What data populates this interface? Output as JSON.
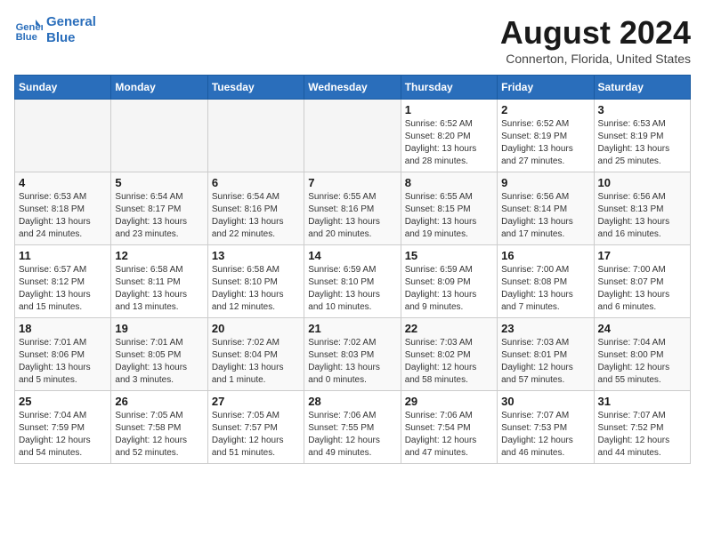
{
  "logo": {
    "line1": "General",
    "line2": "Blue"
  },
  "title": "August 2024",
  "location": "Connerton, Florida, United States",
  "weekdays": [
    "Sunday",
    "Monday",
    "Tuesday",
    "Wednesday",
    "Thursday",
    "Friday",
    "Saturday"
  ],
  "weeks": [
    [
      {
        "day": "",
        "empty": true
      },
      {
        "day": "",
        "empty": true
      },
      {
        "day": "",
        "empty": true
      },
      {
        "day": "",
        "empty": true
      },
      {
        "day": "1",
        "sunrise": "6:52 AM",
        "sunset": "8:20 PM",
        "daylight": "13 hours and 28 minutes."
      },
      {
        "day": "2",
        "sunrise": "6:52 AM",
        "sunset": "8:19 PM",
        "daylight": "13 hours and 27 minutes."
      },
      {
        "day": "3",
        "sunrise": "6:53 AM",
        "sunset": "8:19 PM",
        "daylight": "13 hours and 25 minutes."
      }
    ],
    [
      {
        "day": "4",
        "sunrise": "6:53 AM",
        "sunset": "8:18 PM",
        "daylight": "13 hours and 24 minutes."
      },
      {
        "day": "5",
        "sunrise": "6:54 AM",
        "sunset": "8:17 PM",
        "daylight": "13 hours and 23 minutes."
      },
      {
        "day": "6",
        "sunrise": "6:54 AM",
        "sunset": "8:16 PM",
        "daylight": "13 hours and 22 minutes."
      },
      {
        "day": "7",
        "sunrise": "6:55 AM",
        "sunset": "8:16 PM",
        "daylight": "13 hours and 20 minutes."
      },
      {
        "day": "8",
        "sunrise": "6:55 AM",
        "sunset": "8:15 PM",
        "daylight": "13 hours and 19 minutes."
      },
      {
        "day": "9",
        "sunrise": "6:56 AM",
        "sunset": "8:14 PM",
        "daylight": "13 hours and 17 minutes."
      },
      {
        "day": "10",
        "sunrise": "6:56 AM",
        "sunset": "8:13 PM",
        "daylight": "13 hours and 16 minutes."
      }
    ],
    [
      {
        "day": "11",
        "sunrise": "6:57 AM",
        "sunset": "8:12 PM",
        "daylight": "13 hours and 15 minutes."
      },
      {
        "day": "12",
        "sunrise": "6:58 AM",
        "sunset": "8:11 PM",
        "daylight": "13 hours and 13 minutes."
      },
      {
        "day": "13",
        "sunrise": "6:58 AM",
        "sunset": "8:10 PM",
        "daylight": "13 hours and 12 minutes."
      },
      {
        "day": "14",
        "sunrise": "6:59 AM",
        "sunset": "8:10 PM",
        "daylight": "13 hours and 10 minutes."
      },
      {
        "day": "15",
        "sunrise": "6:59 AM",
        "sunset": "8:09 PM",
        "daylight": "13 hours and 9 minutes."
      },
      {
        "day": "16",
        "sunrise": "7:00 AM",
        "sunset": "8:08 PM",
        "daylight": "13 hours and 7 minutes."
      },
      {
        "day": "17",
        "sunrise": "7:00 AM",
        "sunset": "8:07 PM",
        "daylight": "13 hours and 6 minutes."
      }
    ],
    [
      {
        "day": "18",
        "sunrise": "7:01 AM",
        "sunset": "8:06 PM",
        "daylight": "13 hours and 5 minutes."
      },
      {
        "day": "19",
        "sunrise": "7:01 AM",
        "sunset": "8:05 PM",
        "daylight": "13 hours and 3 minutes."
      },
      {
        "day": "20",
        "sunrise": "7:02 AM",
        "sunset": "8:04 PM",
        "daylight": "13 hours and 1 minute."
      },
      {
        "day": "21",
        "sunrise": "7:02 AM",
        "sunset": "8:03 PM",
        "daylight": "13 hours and 0 minutes."
      },
      {
        "day": "22",
        "sunrise": "7:03 AM",
        "sunset": "8:02 PM",
        "daylight": "12 hours and 58 minutes."
      },
      {
        "day": "23",
        "sunrise": "7:03 AM",
        "sunset": "8:01 PM",
        "daylight": "12 hours and 57 minutes."
      },
      {
        "day": "24",
        "sunrise": "7:04 AM",
        "sunset": "8:00 PM",
        "daylight": "12 hours and 55 minutes."
      }
    ],
    [
      {
        "day": "25",
        "sunrise": "7:04 AM",
        "sunset": "7:59 PM",
        "daylight": "12 hours and 54 minutes."
      },
      {
        "day": "26",
        "sunrise": "7:05 AM",
        "sunset": "7:58 PM",
        "daylight": "12 hours and 52 minutes."
      },
      {
        "day": "27",
        "sunrise": "7:05 AM",
        "sunset": "7:57 PM",
        "daylight": "12 hours and 51 minutes."
      },
      {
        "day": "28",
        "sunrise": "7:06 AM",
        "sunset": "7:55 PM",
        "daylight": "12 hours and 49 minutes."
      },
      {
        "day": "29",
        "sunrise": "7:06 AM",
        "sunset": "7:54 PM",
        "daylight": "12 hours and 47 minutes."
      },
      {
        "day": "30",
        "sunrise": "7:07 AM",
        "sunset": "7:53 PM",
        "daylight": "12 hours and 46 minutes."
      },
      {
        "day": "31",
        "sunrise": "7:07 AM",
        "sunset": "7:52 PM",
        "daylight": "12 hours and 44 minutes."
      }
    ]
  ]
}
